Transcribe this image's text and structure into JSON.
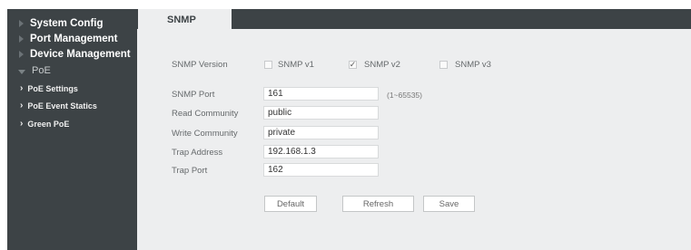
{
  "sidebar": {
    "items": [
      {
        "label": "System Config"
      },
      {
        "label": "Port Management"
      },
      {
        "label": "Device Management"
      },
      {
        "label": "PoE"
      }
    ],
    "poe_subitems": [
      {
        "label": "PoE Settings"
      },
      {
        "label": "PoE Event Statics"
      },
      {
        "label": "Green PoE"
      }
    ]
  },
  "tab": {
    "label": "SNMP"
  },
  "form": {
    "version": {
      "label": "SNMP Version",
      "options": [
        {
          "label": "SNMP v1",
          "checked": false
        },
        {
          "label": "SNMP v2",
          "checked": true
        },
        {
          "label": "SNMP v3",
          "checked": false
        }
      ]
    },
    "port": {
      "label": "SNMP Port",
      "value": "161",
      "hint": "(1~65535)"
    },
    "read_community": {
      "label": "Read Community",
      "value": "public"
    },
    "write_community": {
      "label": "Write Community",
      "value": "private"
    },
    "trap_address": {
      "label": "Trap Address",
      "value": "192.168.1.3"
    },
    "trap_port": {
      "label": "Trap Port",
      "value": "162"
    }
  },
  "buttons": {
    "default": "Default",
    "refresh": "Refresh",
    "save": "Save"
  },
  "colors": {
    "sidebar": "#3d4346",
    "content": "#edeeef"
  }
}
